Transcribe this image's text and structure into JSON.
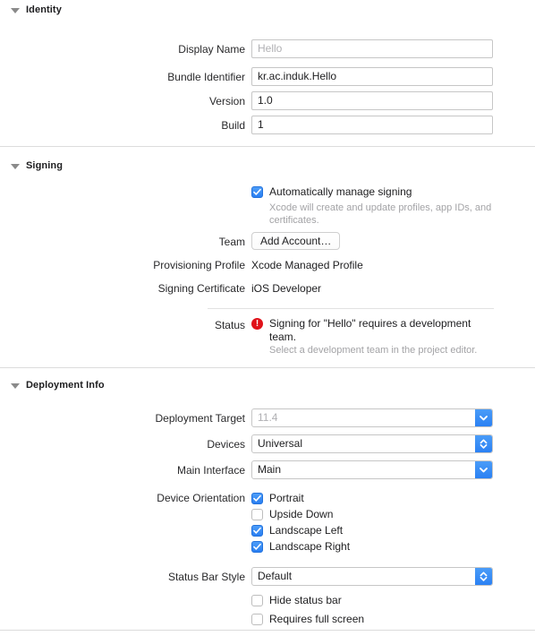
{
  "sections": {
    "identity": {
      "title": "Identity",
      "fields": [
        {
          "label": "Display Name",
          "value": "Hello",
          "placeholder": true
        },
        {
          "label": "Bundle Identifier",
          "value": "kr.ac.induk.Hello",
          "placeholder": false
        },
        {
          "label": "Version",
          "value": "1.0",
          "placeholder": false
        },
        {
          "label": "Build",
          "value": "1",
          "placeholder": false
        }
      ]
    },
    "signing": {
      "title": "Signing",
      "auto_manage": {
        "label": "Automatically manage signing",
        "checked": true,
        "help": "Xcode will create and update profiles, app IDs, and certificates."
      },
      "team": {
        "label": "Team",
        "button_label": "Add Account…"
      },
      "provisioning_profile": {
        "label": "Provisioning Profile",
        "value": "Xcode Managed Profile"
      },
      "signing_certificate": {
        "label": "Signing Certificate",
        "value": "iOS Developer"
      },
      "status": {
        "label": "Status",
        "icon": "error-icon",
        "icon_color": "#e0121a",
        "message": "Signing for \"Hello\" requires a development team.",
        "detail": "Select a development team in the project editor."
      }
    },
    "deployment_info": {
      "title": "Deployment Info",
      "deployment_target": {
        "label": "Deployment Target",
        "value": "11.4",
        "placeholder": true,
        "control": "combo-box",
        "icon": "chevron-down-icon"
      },
      "devices": {
        "label": "Devices",
        "value": "Universal",
        "placeholder": false,
        "control": "popup-button",
        "icon": "chevron-up-down-icon"
      },
      "main_interface": {
        "label": "Main Interface",
        "value": "Main",
        "placeholder": false,
        "control": "combo-box",
        "icon": "chevron-down-icon"
      },
      "device_orientation": {
        "label": "Device Orientation",
        "options": [
          {
            "label": "Portrait",
            "checked": true
          },
          {
            "label": "Upside Down",
            "checked": false
          },
          {
            "label": "Landscape Left",
            "checked": true
          },
          {
            "label": "Landscape Right",
            "checked": true
          }
        ]
      },
      "status_bar_style": {
        "label": "Status Bar Style",
        "value": "Default",
        "placeholder": false,
        "control": "popup-button",
        "icon": "chevron-up-down-icon"
      },
      "extra_options": [
        {
          "label": "Hide status bar",
          "checked": false
        },
        {
          "label": "Requires full screen",
          "checked": false
        }
      ]
    }
  },
  "colors": {
    "accent_blue": "#2a7ff2",
    "error_red": "#e0121a",
    "divider": "#dcdcdc",
    "field_border": "#c6c6c6",
    "placeholder_text": "#b0b0b3",
    "help_text": "#a3a3a6"
  }
}
